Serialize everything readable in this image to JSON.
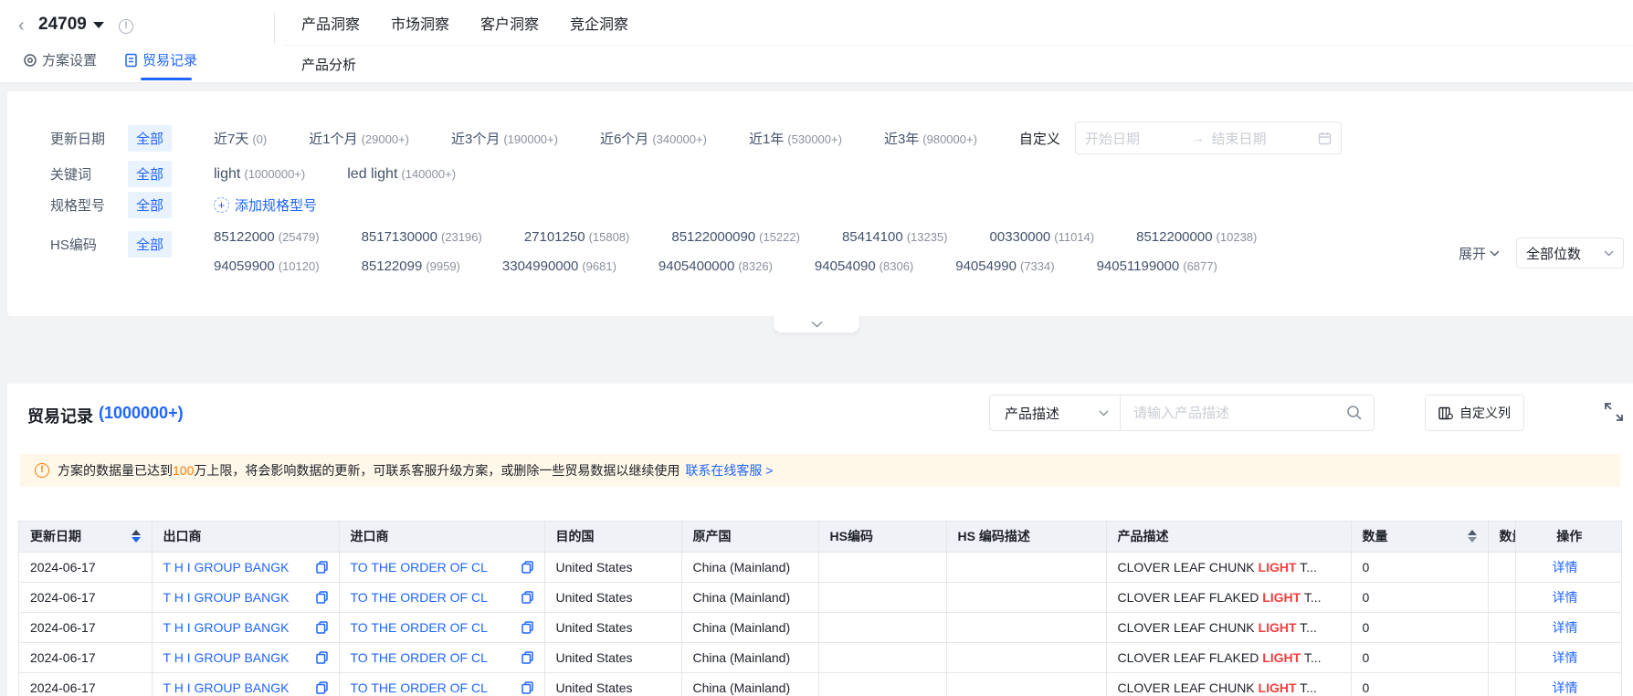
{
  "colors": {
    "primary": "#1e66ff",
    "keyword_red": "#f53f3f",
    "warning_orange": "#ff7d00",
    "banner_bg": "#fff7e8",
    "chip_bg": "#e9f2ff",
    "table_header_bg": "#f1f2f8"
  },
  "header": {
    "back_icon": "‹",
    "title": "24709",
    "info_icon": "!",
    "tabs": [
      {
        "label": "方案设置"
      },
      {
        "label": "贸易记录"
      }
    ],
    "nav": [
      {
        "label": "产品洞察"
      },
      {
        "label": "市场洞察"
      },
      {
        "label": "客户洞察"
      },
      {
        "label": "竞企洞察"
      }
    ],
    "subnav": "产品分析"
  },
  "filters": {
    "date": {
      "label": "更新日期",
      "all": "全部",
      "options": [
        {
          "text": "近7天",
          "count": "(0)"
        },
        {
          "text": "近1个月",
          "count": "(29000+)"
        },
        {
          "text": "近3个月",
          "count": "(190000+)"
        },
        {
          "text": "近6个月",
          "count": "(340000+)"
        },
        {
          "text": "近1年",
          "count": "(530000+)"
        },
        {
          "text": "近3年",
          "count": "(980000+)"
        }
      ],
      "custom": "自定义",
      "start_placeholder": "开始日期",
      "end_placeholder": "结束日期"
    },
    "keyword": {
      "label": "关键词",
      "all": "全部",
      "options": [
        {
          "text": "light",
          "count": "(1000000+)"
        },
        {
          "text": "led light",
          "count": "(140000+)"
        }
      ]
    },
    "spec": {
      "label": "规格型号",
      "all": "全部",
      "add": "添加规格型号"
    },
    "hs": {
      "label": "HS编码",
      "all": "全部",
      "line1": [
        {
          "text": "85122000",
          "count": "(25479)"
        },
        {
          "text": "8517130000",
          "count": "(23196)"
        },
        {
          "text": "27101250",
          "count": "(15808)"
        },
        {
          "text": "85122000090",
          "count": "(15222)"
        },
        {
          "text": "85414100",
          "count": "(13235)"
        },
        {
          "text": "00330000",
          "count": "(11014)"
        },
        {
          "text": "8512200000",
          "count": "(10238)"
        }
      ],
      "line2": [
        {
          "text": "94059900",
          "count": "(10120)"
        },
        {
          "text": "85122099",
          "count": "(9959)"
        },
        {
          "text": "3304990000",
          "count": "(9681)"
        },
        {
          "text": "9405400000",
          "count": "(8326)"
        },
        {
          "text": "94054090",
          "count": "(8306)"
        },
        {
          "text": "94054990",
          "count": "(7334)"
        },
        {
          "text": "94051199000",
          "count": "(6877)"
        }
      ],
      "expand": "展开",
      "digits": "全部位数"
    }
  },
  "main": {
    "title": "贸易记录",
    "count": "(1000000+)",
    "search_field": "产品描述",
    "search_placeholder": "请输入产品描述",
    "customize": "自定义列",
    "banner": {
      "pre": "方案的数据量已达到",
      "highlight": "100",
      "post": "万上限，将会影响数据的更新，可联系客服升级方案，或删除一些贸易数据以继续使用",
      "link": "联系在线客服 >"
    }
  },
  "table": {
    "headers": [
      "更新日期",
      "出口商",
      "进口商",
      "目的国",
      "原产国",
      "HS编码",
      "HS 编码描述",
      "产品描述",
      "数量",
      "数量单位",
      "操作"
    ],
    "rows": [
      {
        "date": "2024-06-17",
        "exporter": "T H I GROUP BANGK",
        "importer": "TO THE ORDER OF CL",
        "destination": "United States",
        "origin": "China (Mainland)",
        "hs_code": "",
        "hs_desc": "",
        "product_pre": "CLOVER LEAF CHUNK ",
        "product_kw": "LIGHT",
        "product_post": " T...",
        "qty": "0",
        "unit": "",
        "action": "详情"
      },
      {
        "date": "2024-06-17",
        "exporter": "T H I GROUP BANGK",
        "importer": "TO THE ORDER OF CL",
        "destination": "United States",
        "origin": "China (Mainland)",
        "hs_code": "",
        "hs_desc": "",
        "product_pre": "CLOVER LEAF FLAKED ",
        "product_kw": "LIGHT",
        "product_post": " T...",
        "qty": "0",
        "unit": "",
        "action": "详情"
      },
      {
        "date": "2024-06-17",
        "exporter": "T H I GROUP BANGK",
        "importer": "TO THE ORDER OF CL",
        "destination": "United States",
        "origin": "China (Mainland)",
        "hs_code": "",
        "hs_desc": "",
        "product_pre": "CLOVER LEAF CHUNK ",
        "product_kw": "LIGHT",
        "product_post": " T...",
        "qty": "0",
        "unit": "",
        "action": "详情"
      },
      {
        "date": "2024-06-17",
        "exporter": "T H I GROUP BANGK",
        "importer": "TO THE ORDER OF CL",
        "destination": "United States",
        "origin": "China (Mainland)",
        "hs_code": "",
        "hs_desc": "",
        "product_pre": "CLOVER LEAF FLAKED ",
        "product_kw": "LIGHT",
        "product_post": " T...",
        "qty": "0",
        "unit": "",
        "action": "详情"
      },
      {
        "date": "2024-06-17",
        "exporter": "T H I GROUP BANGK",
        "importer": "TO THE ORDER OF CL",
        "destination": "United States",
        "origin": "China (Mainland)",
        "hs_code": "",
        "hs_desc": "",
        "product_pre": "CLOVER LEAF CHUNK ",
        "product_kw": "LIGHT",
        "product_post": " T...",
        "qty": "0",
        "unit": "",
        "action": "详情"
      }
    ]
  }
}
